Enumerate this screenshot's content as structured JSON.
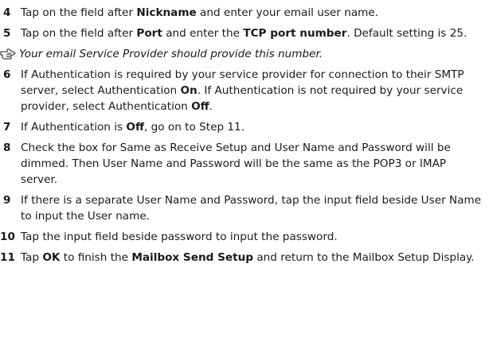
{
  "steps": [
    {
      "number": "4",
      "t1": "Tap on the field after ",
      "b1": "Nickname",
      "t2": " and enter your email user name."
    },
    {
      "number": "5",
      "t1": "Tap on the field after ",
      "b1": "Port",
      "t2": " and enter the ",
      "b2": "TCP port number",
      "t3": ". Default setting is 25."
    },
    {
      "number": "6",
      "t1": "If Authentication is required by your service provider for connection to their SMTP server, select Authentication ",
      "b1": "On",
      "t2": ". If Authentication is not required by your service provider, select Authentication ",
      "b2": "Off",
      "t3": "."
    },
    {
      "number": "7",
      "t1": "If Authentication is ",
      "b1": "Off",
      "t2": ", go on to Step 11."
    },
    {
      "number": "8",
      "text": "Check the box for Same as Receive Setup and User Name and Password will be dimmed. Then User Name and Password will be the same as the POP3 or IMAP server."
    },
    {
      "number": "9",
      "text": "If there is a separate User Name and Password, tap the input field beside User Name to input the User name."
    },
    {
      "number": "10",
      "text": "Tap the input field beside password to input the password."
    },
    {
      "number": "11",
      "t1": "Tap ",
      "b1": "OK",
      "t2": " to finish the ",
      "b2": "Mailbox Send Setup",
      "t3": " and return to the Mailbox Setup Display."
    }
  ],
  "note": {
    "icon": "pointing-hand-icon",
    "text": "Your email Service Provider should provide this number."
  }
}
